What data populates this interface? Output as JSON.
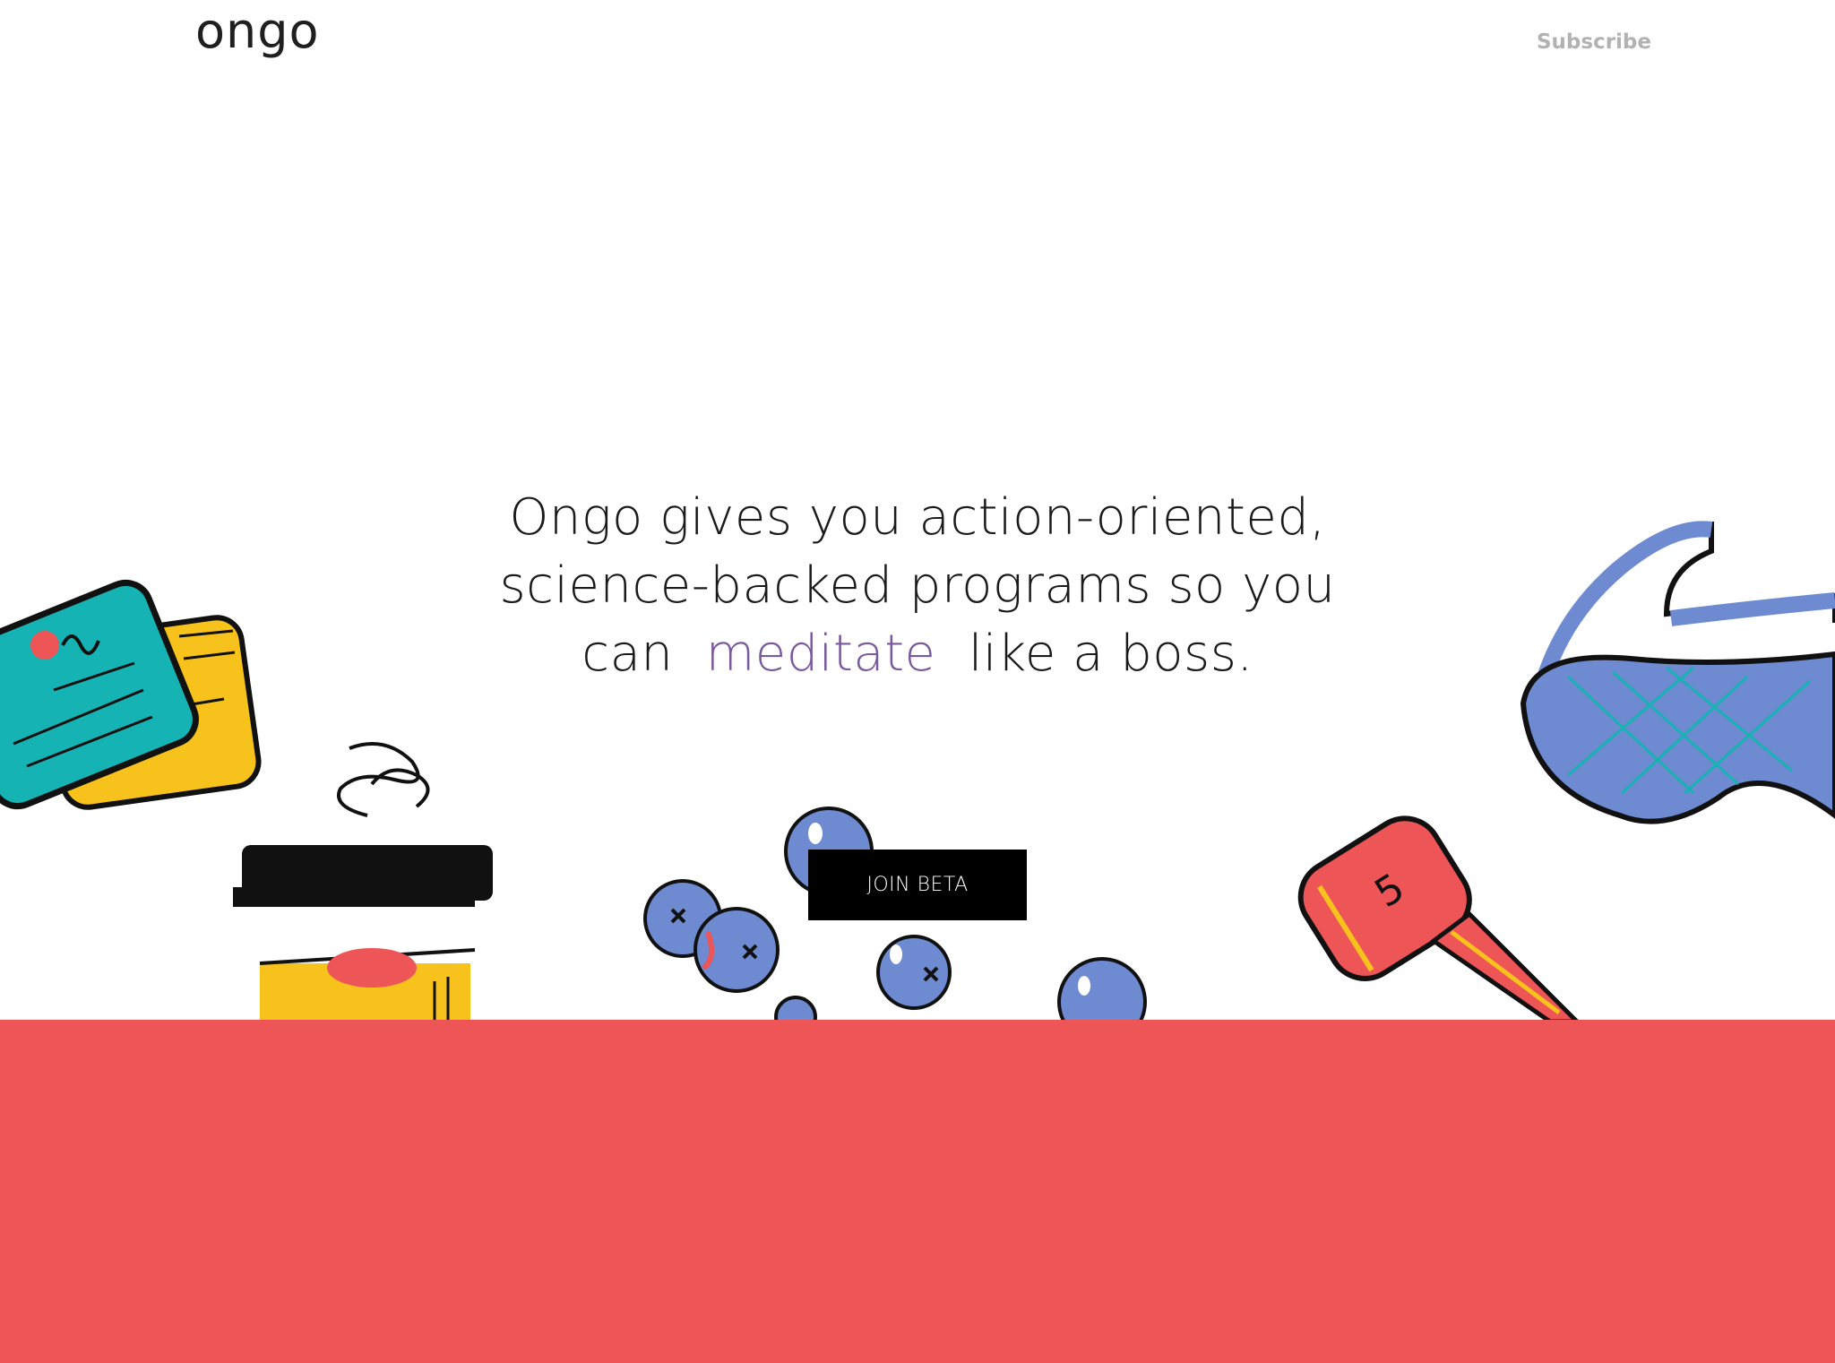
{
  "header": {
    "logo_text": "ongo",
    "subscribe_label": "Subscribe"
  },
  "hero": {
    "line1": "Ongo gives you action-oriented,",
    "line2": "science-backed programs so you",
    "line3_before": "can",
    "highlight_word": "meditate",
    "line3_after": "like a boss.",
    "cta_label": "JOIN BETA"
  },
  "colors": {
    "highlight": "#7a5a9c",
    "cta_background": "#000000",
    "footer_band": "#ee5557",
    "subscribe_text": "#b2b2b2"
  },
  "illustrations": [
    "credit-cards",
    "coffee-cup",
    "blueberries",
    "dumbbell",
    "sleep-mask"
  ]
}
